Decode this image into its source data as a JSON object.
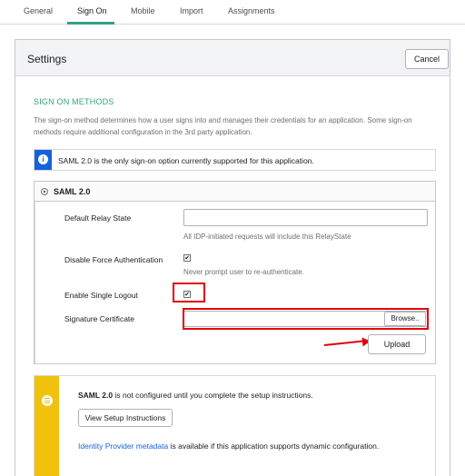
{
  "tabs": [
    {
      "label": "General"
    },
    {
      "label": "Sign On"
    },
    {
      "label": "Mobile"
    },
    {
      "label": "Import"
    },
    {
      "label": "Assignments"
    }
  ],
  "panel": {
    "title": "Settings",
    "cancel_label": "Cancel"
  },
  "sign_on_methods": {
    "heading": "SIGN ON METHODS",
    "description": "The sign-on method determines how a user signs into and manages their credentials for an application. Some sign-on methods require additional configuration in the 3rd party application."
  },
  "info": {
    "icon": "info-icon",
    "message": "SAML 2.0 is the only sign-on option currently supported for this application."
  },
  "saml": {
    "option_label": "SAML 2.0",
    "selected": true,
    "relay_state": {
      "label": "Default Relay State",
      "value": "",
      "placeholder": "",
      "hint": "All IDP-initiated requests will include this RelayState"
    },
    "disable_force_auth": {
      "label": "Disable Force Authentication",
      "checked": true,
      "hint": "Never prompt user to re-authenticate."
    },
    "single_logout": {
      "label": "Enable Single Logout",
      "checked": true
    },
    "signature_cert": {
      "label": "Signature Certificate",
      "value": "",
      "browse_label": "Browse.."
    },
    "upload_label": "Upload",
    "highlight_color": "#e3000b"
  },
  "setup": {
    "icon": "list-icon",
    "bold_text": "SAML 2.0",
    "text": " is not configured until you complete the setup instructions.",
    "button_label": "View Setup Instructions",
    "metadata_link": "Identity Provider metadata",
    "metadata_text": " is available if this application supports dynamic configuration."
  },
  "colors": {
    "accent": "#34a180",
    "info": "#1662dd",
    "warning": "#f0c20c"
  }
}
